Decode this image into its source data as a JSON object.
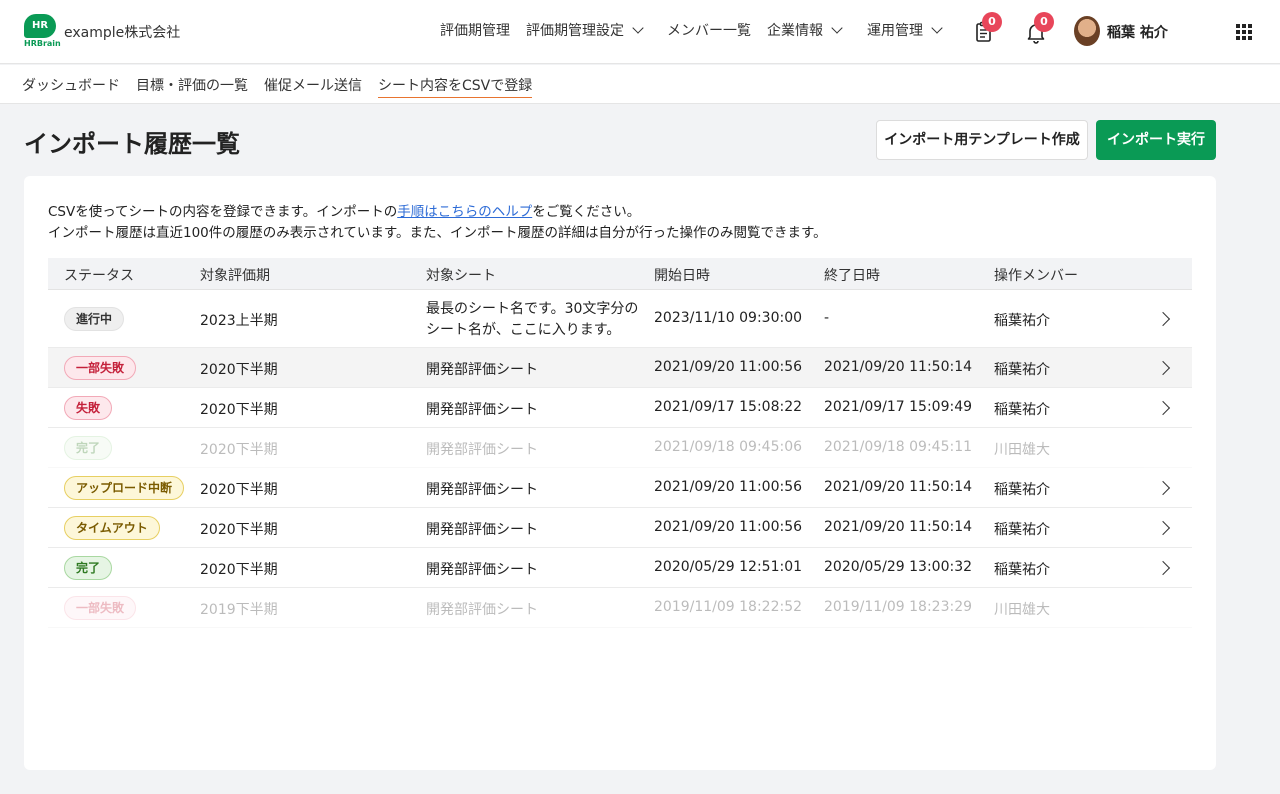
{
  "app": {
    "logo_text": "HR",
    "logo_sub": "HRBrain",
    "company": "example株式会社"
  },
  "nav": {
    "items": [
      {
        "label": "評価期管理"
      },
      {
        "label": "評価期管理設定"
      },
      {
        "label": "メンバー一覧"
      },
      {
        "label": "企業情報"
      },
      {
        "label": "運用管理"
      }
    ],
    "task_count": "0",
    "notification_count": "0",
    "user_name": "稲葉 祐介"
  },
  "subnav": {
    "tabs": [
      {
        "label": "ダッシュボード"
      },
      {
        "label": "目標・評価の一覧"
      },
      {
        "label": "催促メール送信"
      },
      {
        "label": "シート内容をCSVで登録"
      }
    ],
    "active_tab": "シート内容をCSVで登録"
  },
  "page": {
    "title": "インポート履歴一覧",
    "template_button": "インポート用テンプレート作成",
    "import_button": "インポート実行"
  },
  "description": {
    "line1_before": "CSVを使ってシートの内容を登録できます。インポートの",
    "line1_link": "手順はこちらのヘルプ",
    "line1_after": "をご覧ください。",
    "line2": "インポート履歴は直近100件の履歴のみ表示されています。また、インポート履歴の詳細は自分が行った操作のみ閲覧できます。"
  },
  "table": {
    "headers": {
      "status": "ステータス",
      "period": "対象評価期",
      "sheet": "対象シート",
      "start": "開始日時",
      "end": "終了日時",
      "member": "操作メンバー"
    },
    "rows": [
      {
        "status": "進行中",
        "period": "2023上半期",
        "sheet": "最長のシート名です。30文字分のシート名が、ここに入ります。",
        "start": "2023/11/10 09:30:00",
        "end": "-",
        "member": "稲葉祐介"
      },
      {
        "status": "一部失敗",
        "period": "2020下半期",
        "sheet": "開発部評価シート",
        "start": "2021/09/20 11:00:56",
        "end": "2021/09/20 11:50:14",
        "member": "稲葉祐介"
      },
      {
        "status": "失敗",
        "period": "2020下半期",
        "sheet": "開発部評価シート",
        "start": "2021/09/17 15:08:22",
        "end": "2021/09/17 15:09:49",
        "member": "稲葉祐介"
      },
      {
        "status": "完了",
        "period": "2020下半期",
        "sheet": "開発部評価シート",
        "start": "2021/09/18 09:45:06",
        "end": "2021/09/18 09:45:11",
        "member": "川田雄大"
      },
      {
        "status": "アップロード中断",
        "period": "2020下半期",
        "sheet": "開発部評価シート",
        "start": "2021/09/20 11:00:56",
        "end": "2021/09/20 11:50:14",
        "member": "稲葉祐介"
      },
      {
        "status": "タイムアウト",
        "period": "2020下半期",
        "sheet": "開発部評価シート",
        "start": "2021/09/20 11:00:56",
        "end": "2021/09/20 11:50:14",
        "member": "稲葉祐介"
      },
      {
        "status": "完了",
        "period": "2020下半期",
        "sheet": "開発部評価シート",
        "start": "2020/05/29 12:51:01",
        "end": "2020/05/29 13:00:32",
        "member": "稲葉祐介"
      },
      {
        "status": "一部失敗",
        "period": "2019下半期",
        "sheet": "開発部評価シート",
        "start": "2019/11/09 18:22:52",
        "end": "2019/11/09 18:23:29",
        "member": "川田雄大"
      }
    ]
  },
  "colors": {
    "brand": "#0a9a55",
    "link": "#2d6bd6",
    "badge_alert": "#e8465a",
    "active_tab_underline": "#e8742f"
  }
}
